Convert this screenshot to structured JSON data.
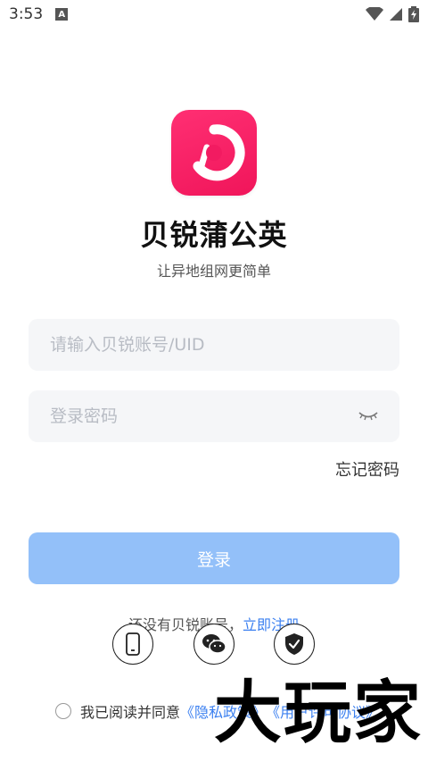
{
  "status_bar": {
    "time": "3:53",
    "notification_icon": "a-icon",
    "icons": [
      "wifi-icon",
      "signal-icon",
      "battery-charging-icon"
    ]
  },
  "app": {
    "name": "贝锐蒲公英",
    "slogan": "让异地组网更简单",
    "icon_color": "#f21b61"
  },
  "login_form": {
    "account_placeholder": "请输入贝锐账号/UID",
    "account_value": "",
    "password_placeholder": "登录密码",
    "password_value": "",
    "forgot_password_label": "忘记密码",
    "login_button_label": "登录",
    "login_button_color": "#93c0f9"
  },
  "register": {
    "prompt": "还没有贝锐账号，",
    "link_label": "立即注册"
  },
  "alt_login": {
    "items": [
      "phone-icon",
      "wechat-icon",
      "shield-check-icon"
    ]
  },
  "agreement": {
    "prefix": "我已阅读并同意",
    "privacy_label": "《隐私政策》",
    "terms_label": "《用户许可协议》",
    "link_color": "#3a7ff0"
  },
  "watermark": {
    "text": "大玩家"
  }
}
